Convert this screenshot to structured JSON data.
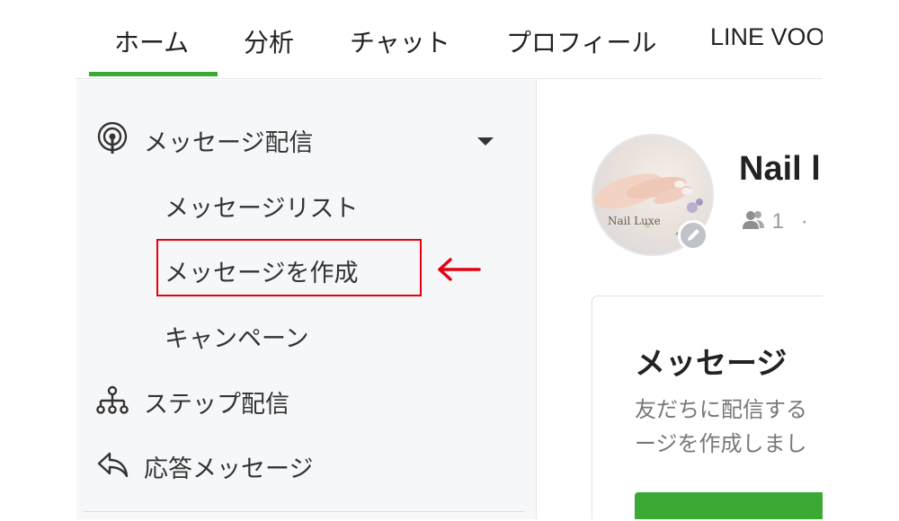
{
  "nav": {
    "tabs": [
      {
        "label": "ホーム",
        "active": true
      },
      {
        "label": "分析"
      },
      {
        "label": "チャット"
      },
      {
        "label": "プロフィール"
      },
      {
        "label": "LINE VOO"
      }
    ],
    "accent_color": "#3aaa35"
  },
  "sidebar": {
    "sections": [
      {
        "label": "メッセージ配信",
        "icon": "broadcast-icon",
        "expanded": true,
        "items": [
          {
            "label": "メッセージリスト"
          },
          {
            "label": "メッセージを作成",
            "highlighted": true
          },
          {
            "label": "キャンペーン"
          }
        ]
      },
      {
        "label": "ステップ配信",
        "icon": "step-tree-icon"
      },
      {
        "label": "応答メッセージ",
        "icon": "reply-icon"
      }
    ],
    "highlight_color": "#e60012"
  },
  "account": {
    "name": "Nail l",
    "avatar_caption": "Nail Luxe",
    "friend_count": "1",
    "separator": "·"
  },
  "card": {
    "title": "メッセージ",
    "desc_line1": "友だちに配信する",
    "desc_line2": "ージを作成しまし"
  }
}
